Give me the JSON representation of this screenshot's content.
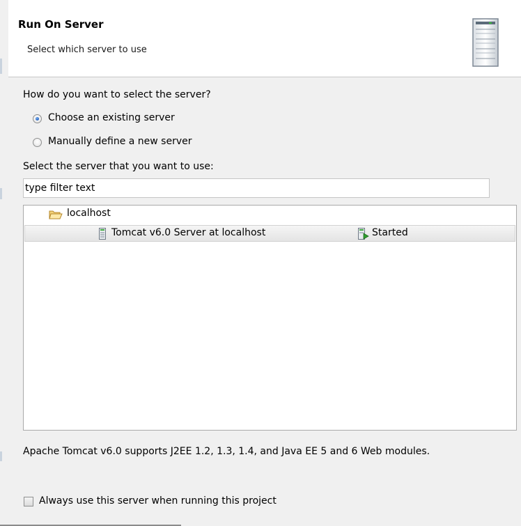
{
  "header": {
    "title": "Run On Server",
    "subtitle": "Select which server to use",
    "icon": "server-tower-icon"
  },
  "selection": {
    "question": "How do you want to select the server?",
    "options": [
      {
        "label": "Choose an existing server",
        "selected": true
      },
      {
        "label": "Manually define a new server",
        "selected": false
      }
    ]
  },
  "server_list": {
    "label": "Select the server that you want to use:",
    "filter_value": "type filter text",
    "host": {
      "name": "localhost",
      "icon": "folder-open-icon"
    },
    "servers": [
      {
        "name": "Tomcat v6.0 Server at localhost",
        "state": "Started",
        "icon": "server-icon",
        "state_icon": "server-started-icon"
      }
    ]
  },
  "description": "Apache Tomcat v6.0 supports J2EE 1.2, 1.3, 1.4, and Java EE 5 and 6 Web modules.",
  "always_use": {
    "label": "Always use this server when running this project",
    "checked": false
  },
  "colors": {
    "header_bg": "#ffffff",
    "dialog_bg": "#f0f0f0",
    "radio_selected": "#1f5fbf"
  }
}
